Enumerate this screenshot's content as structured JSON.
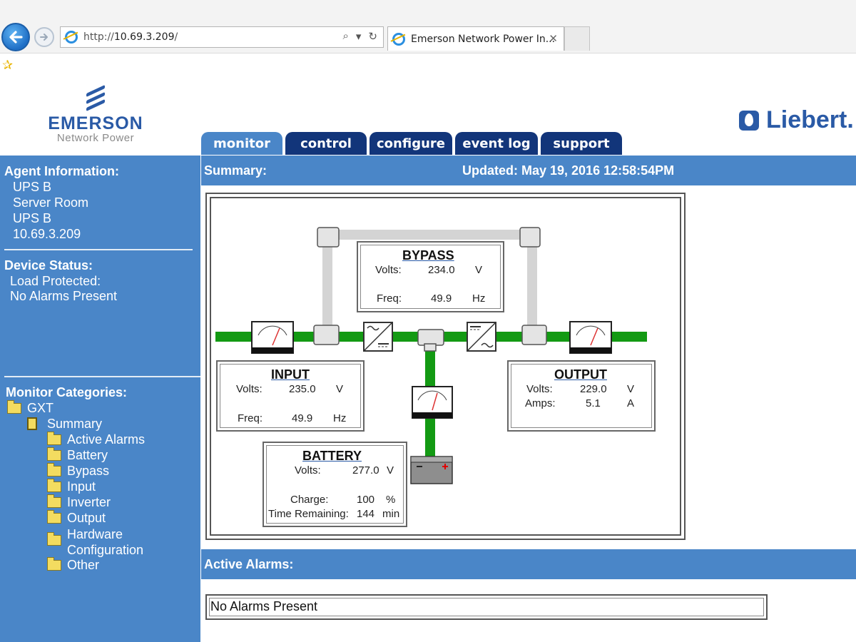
{
  "browser": {
    "url_prefix": "http://",
    "url_host": "10.69.3.209",
    "url_suffix": "/",
    "tab_title": "Emerson Network Power In...",
    "tab_close": "✕",
    "search_icon": "⌕",
    "dropdown_icon": "▾",
    "refresh_icon": "↻",
    "back_icon": "arrow-left",
    "favorites_icon": "star"
  },
  "header": {
    "emerson_name": "EMERSON",
    "emerson_sub": "Network Power",
    "liebert_name": "Liebert."
  },
  "nav": {
    "tabs": [
      "monitor",
      "control",
      "configure",
      "event log",
      "support"
    ],
    "active": "monitor"
  },
  "sidebar": {
    "agent_heading": "Agent Information:",
    "agent_lines": [
      "UPS B",
      "Server Room",
      "UPS B",
      "10.69.3.209"
    ],
    "status_heading": "Device Status:",
    "status_lines": [
      "Load Protected:",
      "No Alarms Present"
    ],
    "categories_heading": "Monitor Categories:",
    "tree_root": "GXT",
    "tree_summary": "Summary",
    "tree_items": [
      "Active Alarms",
      "Battery",
      "Bypass",
      "Input",
      "Inverter",
      "Output"
    ],
    "tree_hardware_1": "Hardware",
    "tree_hardware_2": "Configuration",
    "tree_other": "Other"
  },
  "summary": {
    "title": "Summary:",
    "updated": "Updated: May 19, 2016 12:58:54PM"
  },
  "diagram": {
    "bypass": {
      "title": "BYPASS",
      "volts_label": "Volts:",
      "volts": "234.0",
      "volts_unit": "V",
      "freq_label": "Freq:",
      "freq": "49.9",
      "freq_unit": "Hz"
    },
    "input": {
      "title": "INPUT",
      "volts_label": "Volts:",
      "volts": "235.0",
      "volts_unit": "V",
      "freq_label": "Freq:",
      "freq": "49.9",
      "freq_unit": "Hz"
    },
    "output": {
      "title": "OUTPUT",
      "volts_label": "Volts:",
      "volts": "229.0",
      "volts_unit": "V",
      "amps_label": "Amps:",
      "amps": "5.1",
      "amps_unit": "A"
    },
    "battery": {
      "title": "BATTERY",
      "volts_label": "Volts:",
      "volts": "277.0",
      "volts_unit": "V",
      "charge_label": "Charge:",
      "charge": "100",
      "charge_unit": "%",
      "time_label": "Time Remaining:",
      "time": "144",
      "time_unit": "min"
    },
    "colors": {
      "power_line": "#139a13",
      "bypass_line": "#d4d4d4"
    }
  },
  "alarms": {
    "title": "Active Alarms:",
    "message": "No Alarms Present"
  },
  "colors": {
    "sidebar_bg": "#4a86c8",
    "tab_bg": "#12357a",
    "brand_blue": "#2a5aa6"
  }
}
